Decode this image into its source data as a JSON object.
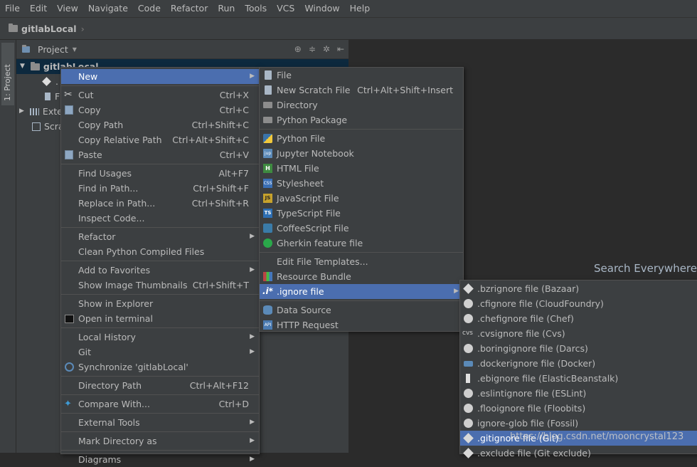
{
  "menubar": [
    "File",
    "Edit",
    "View",
    "Navigate",
    "Code",
    "Refactor",
    "Run",
    "Tools",
    "VCS",
    "Window",
    "Help"
  ],
  "breadcrumb": "gitlabLocal",
  "left_tab": "1: Project",
  "project_panel": {
    "title": "Project",
    "tree": [
      {
        "label": "gitlabLocal",
        "selected": true
      },
      {
        "label": "."
      },
      {
        "label": "F"
      },
      {
        "label": "Exte"
      },
      {
        "label": "Scra"
      }
    ]
  },
  "search_hint": "Search Everywhere",
  "context_menu": [
    {
      "label": "New",
      "shortcut": "",
      "submenu": true,
      "icon": "none-icon",
      "hl": true
    },
    {
      "sep": true
    },
    {
      "label": "Cut",
      "shortcut": "Ctrl+X",
      "icon": "cut-icon"
    },
    {
      "label": "Copy",
      "shortcut": "Ctrl+C",
      "icon": "copy-icon"
    },
    {
      "label": "Copy Path",
      "shortcut": "Ctrl+Shift+C"
    },
    {
      "label": "Copy Relative Path",
      "shortcut": "Ctrl+Alt+Shift+C"
    },
    {
      "label": "Paste",
      "shortcut": "Ctrl+V",
      "icon": "paste-icon"
    },
    {
      "sep": true
    },
    {
      "label": "Find Usages",
      "shortcut": "Alt+F7"
    },
    {
      "label": "Find in Path...",
      "shortcut": "Ctrl+Shift+F"
    },
    {
      "label": "Replace in Path...",
      "shortcut": "Ctrl+Shift+R"
    },
    {
      "label": "Inspect Code...",
      "shortcut": ""
    },
    {
      "sep": true
    },
    {
      "label": "Refactor",
      "shortcut": "",
      "submenu": true
    },
    {
      "label": "Clean Python Compiled Files",
      "shortcut": ""
    },
    {
      "sep": true
    },
    {
      "label": "Add to Favorites",
      "shortcut": "",
      "submenu": true
    },
    {
      "label": "Show Image Thumbnails",
      "shortcut": "Ctrl+Shift+T"
    },
    {
      "sep": true
    },
    {
      "label": "Show in Explorer",
      "shortcut": ""
    },
    {
      "label": "Open in terminal",
      "shortcut": "",
      "icon": "terminal-icon"
    },
    {
      "sep": true
    },
    {
      "label": "Local History",
      "shortcut": "",
      "submenu": true
    },
    {
      "label": "Git",
      "shortcut": "",
      "submenu": true
    },
    {
      "label": "Synchronize 'gitlabLocal'",
      "shortcut": "",
      "icon": "sync-icon"
    },
    {
      "sep": true
    },
    {
      "label": "Directory Path",
      "shortcut": "Ctrl+Alt+F12"
    },
    {
      "sep": true
    },
    {
      "label": "Compare With...",
      "shortcut": "Ctrl+D",
      "icon": "compare-icon"
    },
    {
      "sep": true
    },
    {
      "label": "External Tools",
      "shortcut": "",
      "submenu": true
    },
    {
      "sep": true
    },
    {
      "label": "Mark Directory as",
      "shortcut": "",
      "submenu": true
    },
    {
      "sep": true
    },
    {
      "label": "Diagrams",
      "shortcut": "",
      "submenu": true
    }
  ],
  "new_submenu": [
    {
      "label": "File",
      "shortcut": "",
      "icon": "file-icon"
    },
    {
      "label": "New Scratch File",
      "shortcut": "Ctrl+Alt+Shift+Insert",
      "icon": "scratch-icon"
    },
    {
      "label": "Directory",
      "shortcut": "",
      "icon": "folder-icon"
    },
    {
      "label": "Python Package",
      "shortcut": "",
      "icon": "package-icon"
    },
    {
      "sep": true
    },
    {
      "label": "Python File",
      "shortcut": "",
      "icon": "python-icon"
    },
    {
      "label": "Jupyter Notebook",
      "shortcut": "",
      "icon": "jupyter-icon"
    },
    {
      "label": "HTML File",
      "shortcut": "",
      "icon": "html-icon"
    },
    {
      "label": "Stylesheet",
      "shortcut": "",
      "icon": "css-icon"
    },
    {
      "label": "JavaScript File",
      "shortcut": "",
      "icon": "js-icon"
    },
    {
      "label": "TypeScript File",
      "shortcut": "",
      "icon": "ts-icon"
    },
    {
      "label": "CoffeeScript File",
      "shortcut": "",
      "icon": "coffeescript-icon"
    },
    {
      "label": "Gherkin feature file",
      "shortcut": "",
      "icon": "gherkin-icon"
    },
    {
      "sep": true
    },
    {
      "label": "Edit File Templates...",
      "shortcut": ""
    },
    {
      "label": "Resource Bundle",
      "shortcut": "",
      "icon": "bundle-icon"
    },
    {
      "label": ".ignore file",
      "shortcut": "",
      "icon": "ignore-icon",
      "submenu": true,
      "hl": true
    },
    {
      "sep": true
    },
    {
      "label": "Data Source",
      "shortcut": "",
      "icon": "database-icon"
    },
    {
      "label": "HTTP Request",
      "shortcut": "",
      "icon": "api-icon"
    }
  ],
  "ignore_submenu": [
    {
      "label": ".bzrignore file (Bazaar)",
      "icon": "bazaar-icon"
    },
    {
      "label": ".cfignore file (CloudFoundry)",
      "icon": "cloudfoundry-icon"
    },
    {
      "label": ".chefignore file (Chef)",
      "icon": "chef-icon"
    },
    {
      "label": ".cvsignore file (Cvs)",
      "icon": "cvs-icon"
    },
    {
      "label": ".boringignore file (Darcs)",
      "icon": "darcs-icon"
    },
    {
      "label": ".dockerignore file (Docker)",
      "icon": "docker-icon"
    },
    {
      "label": ".ebignore file (ElasticBeanstalk)",
      "icon": "elasticbeanstalk-icon"
    },
    {
      "label": ".eslintignore file (ESLint)",
      "icon": "eslint-icon"
    },
    {
      "label": ".flooignore file (Floobits)",
      "icon": "floobits-icon"
    },
    {
      "label": "ignore-glob file (Fossil)",
      "icon": "fossil-icon"
    },
    {
      "label": ".gitignore file (Git)",
      "icon": "git-icon",
      "hl": true
    },
    {
      "label": ".exclude file (Git exclude)",
      "icon": "git-exclude-icon"
    }
  ],
  "watermark": "https://blog.csdn.net/mooncrystal123"
}
